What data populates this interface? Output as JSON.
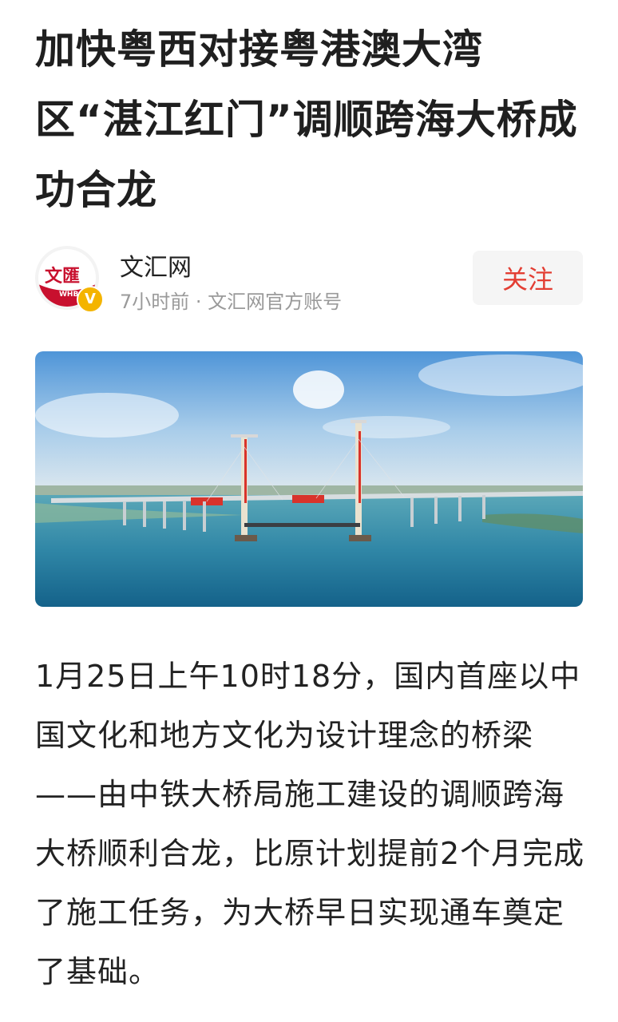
{
  "article": {
    "title": "加快粤西对接粤港澳大湾区“湛江红门”调顺跨海大桥成功合龙",
    "body": "1月25日上午10时18分，国内首座以中国文化和地方文化为设计理念的桥梁——由中铁大桥局施工建设的调顺跨海大桥顺利合龙，比原计划提前2个月完成了施工任务，为大桥早日实现通车奠定了基础。"
  },
  "author": {
    "name": "文汇网",
    "meta": "7小时前 · 文汇网官方账号",
    "avatar_text": "文匯",
    "avatar_sub": "WHB",
    "verified_badge": "V",
    "follow_label": "关注"
  },
  "colors": {
    "follow_text": "#e33e33",
    "brand_red": "#c8102e",
    "verify_badge": "#f4b400"
  },
  "icons": {
    "avatar": "wenhui-logo",
    "verified": "verified-v-icon"
  }
}
